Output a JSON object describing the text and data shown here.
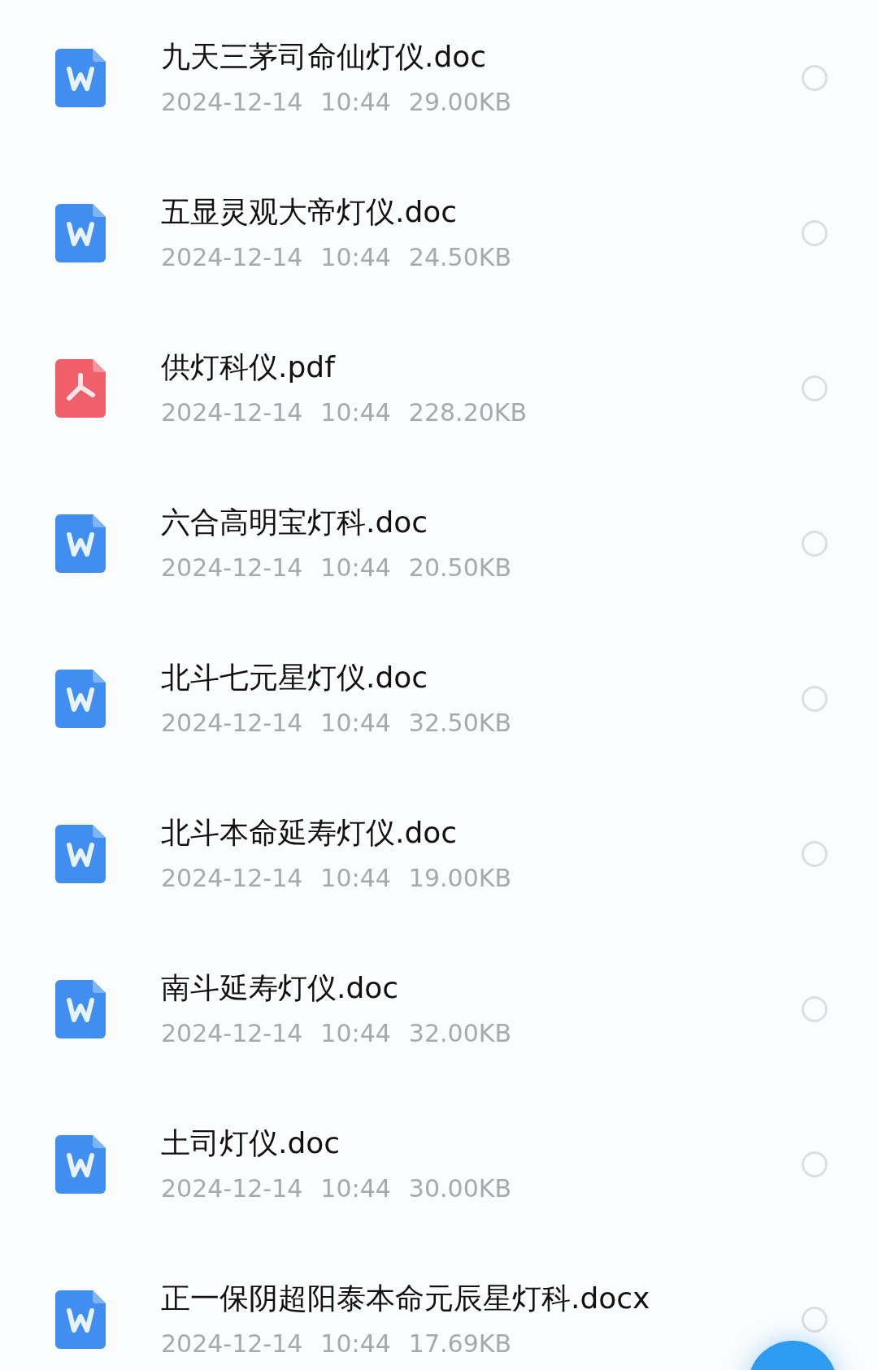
{
  "files": [
    {
      "kind": "word",
      "name": "九天三茅司命仙灯仪.doc",
      "date": "2024-12-14",
      "time": "10:44",
      "size": "29.00KB",
      "selected": false
    },
    {
      "kind": "word",
      "name": "五显灵观大帝灯仪.doc",
      "date": "2024-12-14",
      "time": "10:44",
      "size": "24.50KB",
      "selected": false
    },
    {
      "kind": "pdf",
      "name": "供灯科仪.pdf",
      "date": "2024-12-14",
      "time": "10:44",
      "size": "228.20KB",
      "selected": false
    },
    {
      "kind": "word",
      "name": "六合高明宝灯科.doc",
      "date": "2024-12-14",
      "time": "10:44",
      "size": "20.50KB",
      "selected": false
    },
    {
      "kind": "word",
      "name": "北斗七元星灯仪.doc",
      "date": "2024-12-14",
      "time": "10:44",
      "size": "32.50KB",
      "selected": false
    },
    {
      "kind": "word",
      "name": "北斗本命延寿灯仪.doc",
      "date": "2024-12-14",
      "time": "10:44",
      "size": "19.00KB",
      "selected": false
    },
    {
      "kind": "word",
      "name": "南斗延寿灯仪.doc",
      "date": "2024-12-14",
      "time": "10:44",
      "size": "32.00KB",
      "selected": false
    },
    {
      "kind": "word",
      "name": "土司灯仪.doc",
      "date": "2024-12-14",
      "time": "10:44",
      "size": "30.00KB",
      "selected": false
    },
    {
      "kind": "word",
      "name": "正一保阴超阳泰本命元辰星灯科.docx",
      "date": "2024-12-14",
      "time": "10:44",
      "size": "17.69KB",
      "selected": false
    }
  ]
}
